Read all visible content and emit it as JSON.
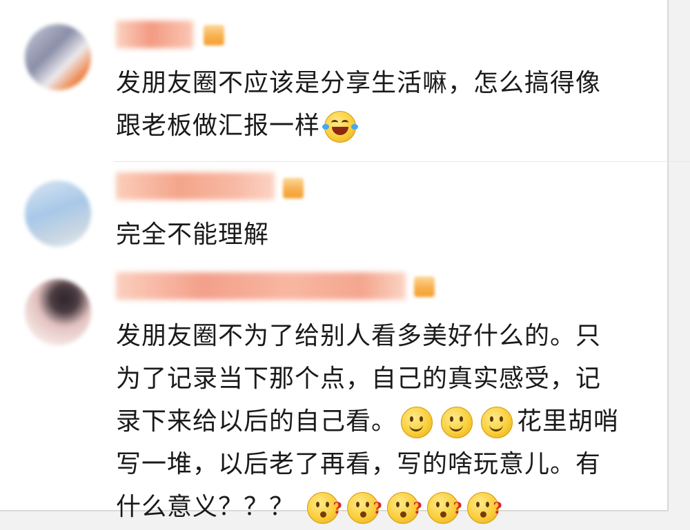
{
  "comments": [
    {
      "text_lines": [
        "发朋友圈不应该是分享生活嘛，怎么搞得像",
        "跟老板做汇报一样"
      ],
      "emojis": [
        "laughing-crying-emoji"
      ],
      "avatar_colors": [
        "#b0b4c8",
        "#e9e6ea",
        "#f06a1c"
      ]
    },
    {
      "text_lines": [
        "完全不能理解"
      ],
      "emojis": [],
      "avatar_colors": [
        "#9ec2e6",
        "#d8e6f2",
        "#c4d2de"
      ]
    },
    {
      "text_lines": [
        "发朋友圈不为了给别人看多美好什么的。只",
        "为了记录当下那个点，自己的真实感受，记",
        "录下来给以后的自己看。",
        "花里胡哨",
        "写一堆，以后老了再看，写的啥玩意儿。有",
        "什么意义？？？"
      ],
      "emojis_inline_1": [
        "smile-emoji",
        "smile-emoji",
        "smile-emoji"
      ],
      "emojis_inline_2": [
        "thinking-question-emoji",
        "thinking-question-emoji",
        "thinking-question-emoji",
        "thinking-question-emoji",
        "thinking-question-emoji"
      ],
      "avatar_colors": [
        "#3a2e34",
        "#e8c8c6",
        "#f4e3df"
      ]
    }
  ],
  "colors": {
    "name_blur": "#f6a98c",
    "badge": "#f5a030",
    "text": "#1a1a1a",
    "background": "#ffffff"
  }
}
